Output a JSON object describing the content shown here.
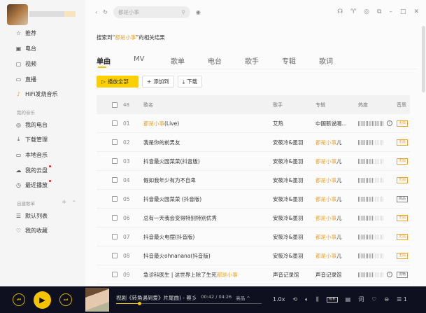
{
  "sidebar": {
    "items": [
      {
        "icon": "star-icon",
        "glyph": "☆",
        "label": "推荐"
      },
      {
        "icon": "radio-icon",
        "glyph": "▣",
        "label": "电台"
      },
      {
        "icon": "video-icon",
        "glyph": "▢",
        "label": "视频"
      },
      {
        "icon": "live-icon",
        "glyph": "▭",
        "label": "直播"
      },
      {
        "icon": "hifi-icon",
        "glyph": "♪",
        "label": "HiFi发烧音乐"
      }
    ],
    "my_music_label": "我的音乐",
    "my_items": [
      {
        "icon": "my-radio-icon",
        "glyph": "◎",
        "label": "我的电台",
        "dot": false
      },
      {
        "icon": "download-icon",
        "glyph": "⤓",
        "label": "下载管理",
        "dot": false
      },
      {
        "icon": "monitor-icon",
        "glyph": "▭",
        "label": "本地音乐",
        "dot": false
      },
      {
        "icon": "cloud-icon",
        "glyph": "☁",
        "label": "我的云盘",
        "dot": true
      },
      {
        "icon": "clock-icon",
        "glyph": "◷",
        "label": "最近播放",
        "dot": true
      }
    ],
    "playlist_label": "自建歌单",
    "playlist_add": "+",
    "playlist_collapse": "^",
    "playlists": [
      {
        "icon": "list-icon",
        "glyph": "☰",
        "label": "默认列表"
      },
      {
        "icon": "heart-icon",
        "glyph": "♡",
        "label": "我的收藏"
      }
    ]
  },
  "search": {
    "value": "都是小事"
  },
  "result": {
    "prefix": "搜索到“",
    "keyword": "都是小事",
    "suffix": "”的相关结果"
  },
  "tabs": [
    "单曲",
    "MV",
    "歌单",
    "电台",
    "歌手",
    "专辑",
    "歌词"
  ],
  "actions": {
    "play_all": "播放全部",
    "add_to": "添加到",
    "download": "下载"
  },
  "table": {
    "headers": {
      "count": "48",
      "title": "歌名",
      "artist": "歌手",
      "album": "专辑",
      "heat": "热度",
      "quality": "音质"
    },
    "rows": [
      {
        "num": "01",
        "title_hl": "都是小事",
        "title": "(Live)",
        "artist": "艾热",
        "album": "中国新说唱...",
        "album_hl": "",
        "heat": "hi",
        "info": true,
        "quality": "无损",
        "qgray": false
      },
      {
        "num": "02",
        "title_hl": "",
        "title": "我是你的前男友",
        "artist": "安筱冷&墨羽",
        "album_hl": "都是小事",
        "album": "儿",
        "heat": "lo",
        "info": false,
        "quality": "无损",
        "qgray": false
      },
      {
        "num": "03",
        "title_hl": "",
        "title": "抖音最火园菜菜(抖音版)",
        "artist": "安筱冷&墨羽",
        "album_hl": "都是小事",
        "album": "儿",
        "heat": "lo",
        "info": false,
        "quality": "无损",
        "qgray": false
      },
      {
        "num": "04",
        "title_hl": "",
        "title": "假如我年少有为不自卑",
        "artist": "安筱冷&墨羽",
        "album_hl": "都是小事",
        "album": "儿",
        "heat": "lo",
        "info": false,
        "quality": "无损",
        "qgray": false
      },
      {
        "num": "05",
        "title_hl": "",
        "title": "抖音最火园菜菜 (抖音版)",
        "artist": "安筱冷&墨羽",
        "album_hl": "都是小事",
        "album": "儿",
        "heat": "lo",
        "info": false,
        "quality": "高品",
        "qgray": true
      },
      {
        "num": "06",
        "title_hl": "",
        "title": "总有一天我会变得特别特别优秀",
        "artist": "安筱冷&墨羽",
        "album_hl": "都是小事",
        "album": "儿",
        "heat": "lo",
        "info": false,
        "quality": "无损",
        "qgray": false
      },
      {
        "num": "07",
        "title_hl": "",
        "title": "抖音最火电摆(抖音版)",
        "artist": "安筱冷&墨羽",
        "album_hl": "都是小事",
        "album": "儿",
        "heat": "lo",
        "info": false,
        "quality": "无损",
        "qgray": false
      },
      {
        "num": "08",
        "title_hl": "",
        "title": "抖音最火ohnanana(抖音版)",
        "artist": "安筱冷&墨羽",
        "album_hl": "都是小事",
        "album": "儿",
        "heat": "lo",
        "info": false,
        "quality": "无损",
        "qgray": false
      },
      {
        "num": "09",
        "title_hl": "",
        "title": "急诊科医生 | 这世界上除了生死",
        "title_tail_hl": "都是小事",
        "artist": "声音记录馆",
        "album_hl": "",
        "album": "声音记录馆",
        "heat": "lo",
        "info": true,
        "quality": "流畅",
        "qgray": true
      }
    ]
  },
  "player": {
    "title": "视剧《转角遇到爱》片尾曲) - 蔡彡",
    "time": "00:42 / 04:26",
    "quality": "高品 ^",
    "speed": "1.0x",
    "hifi": "HiFi",
    "queue_count": "1",
    "progress": 0.16
  },
  "colors": {
    "accent": "#f5c400",
    "highlight": "#e8a630",
    "player_bg": "#0e1020"
  }
}
